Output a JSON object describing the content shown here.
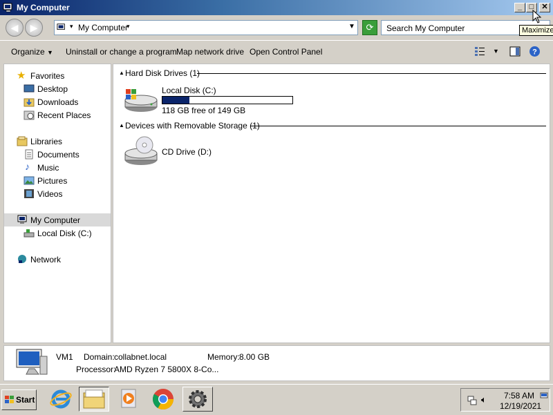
{
  "window": {
    "title": "My Computer"
  },
  "tooltip": "Maximize",
  "address": {
    "path": "My Computer"
  },
  "search": {
    "placeholder": "Search My Computer"
  },
  "toolbar": {
    "organize": "Organize",
    "uninstall": "Uninstall or change a program",
    "map_drive": "Map network drive",
    "control_panel": "Open Control Panel"
  },
  "sidebar": {
    "favorites": "Favorites",
    "desktop": "Desktop",
    "downloads": "Downloads",
    "recent": "Recent Places",
    "libraries": "Libraries",
    "documents": "Documents",
    "music": "Music",
    "pictures": "Pictures",
    "videos": "Videos",
    "computer": "My Computer",
    "local_disk": "Local Disk (C:)",
    "network": "Network"
  },
  "content": {
    "hdd_group": "Hard Disk Drives (1)",
    "local_disk": {
      "name": "Local Disk (C:)",
      "free_text": "118 GB free of 149 GB",
      "used_fraction": 0.21
    },
    "removable_group": "Devices with Removable Storage (1)",
    "cd_drive": "CD Drive (D:)"
  },
  "details": {
    "name": "VM1",
    "domain_label": "Domain:",
    "domain": "collabnet.local",
    "memory_label": "Memory:",
    "memory": "8.00 GB",
    "processor_label": "Processor:",
    "processor": "AMD Ryzen 7 5800X 8-Co..."
  },
  "taskbar": {
    "start": "Start",
    "time": "7:58 AM",
    "date": "12/19/2021"
  },
  "colors": {
    "title_start": "#0a246a",
    "title_end": "#a6caf0",
    "disk_bar": "#0a246a"
  }
}
